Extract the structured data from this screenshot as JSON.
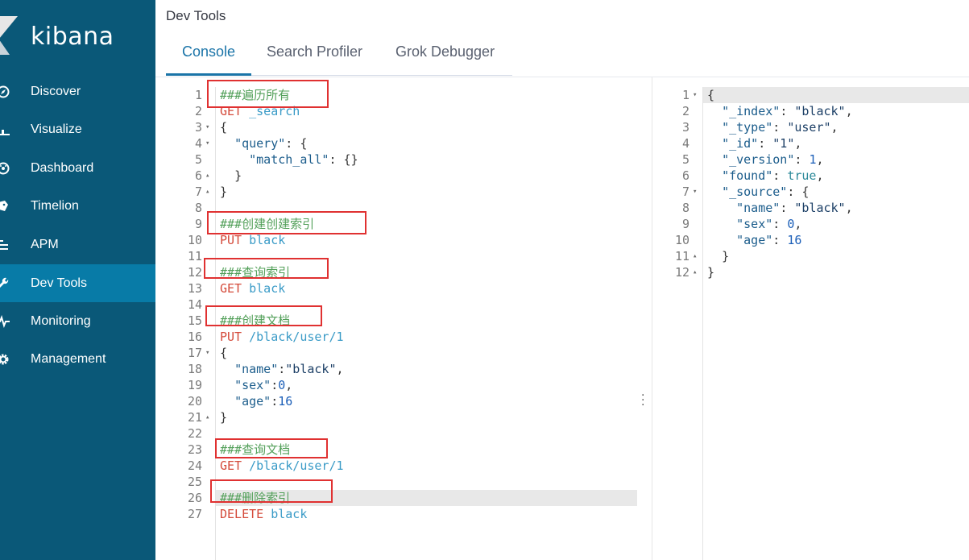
{
  "brand": {
    "name": "kibana"
  },
  "sidebar": {
    "items": [
      {
        "label": "Discover",
        "icon": "compass-icon"
      },
      {
        "label": "Visualize",
        "icon": "bar-chart-icon"
      },
      {
        "label": "Dashboard",
        "icon": "dashboard-icon"
      },
      {
        "label": "Timelion",
        "icon": "timelion-icon"
      },
      {
        "label": "APM",
        "icon": "apm-icon"
      },
      {
        "label": "Dev Tools",
        "icon": "wrench-icon",
        "active": true
      },
      {
        "label": "Monitoring",
        "icon": "heartbeat-icon"
      },
      {
        "label": "Management",
        "icon": "gear-icon"
      }
    ]
  },
  "header": {
    "title": "Dev Tools",
    "tabs": [
      {
        "label": "Console",
        "active": true
      },
      {
        "label": "Search Profiler"
      },
      {
        "label": "Grok Debugger"
      }
    ]
  },
  "request": {
    "lines": [
      {
        "n": "1",
        "text": "###遍历所有",
        "fold": ""
      },
      {
        "n": "2",
        "text": "GET _search",
        "fold": ""
      },
      {
        "n": "3",
        "text": "{",
        "fold": "▾"
      },
      {
        "n": "4",
        "text": "  \"query\": {",
        "fold": "▾"
      },
      {
        "n": "5",
        "text": "    \"match_all\": {}",
        "fold": ""
      },
      {
        "n": "6",
        "text": "  }",
        "fold": "▴"
      },
      {
        "n": "7",
        "text": "}",
        "fold": "▴"
      },
      {
        "n": "8",
        "text": "",
        "fold": ""
      },
      {
        "n": "9",
        "text": "###创建创建索引",
        "fold": ""
      },
      {
        "n": "10",
        "text": "PUT black",
        "fold": ""
      },
      {
        "n": "11",
        "text": "",
        "fold": ""
      },
      {
        "n": "12",
        "text": "###查询索引",
        "fold": ""
      },
      {
        "n": "13",
        "text": "GET black",
        "fold": ""
      },
      {
        "n": "14",
        "text": "",
        "fold": ""
      },
      {
        "n": "15",
        "text": "###创建文档",
        "fold": ""
      },
      {
        "n": "16",
        "text": "PUT /black/user/1",
        "fold": ""
      },
      {
        "n": "17",
        "text": "{",
        "fold": "▾"
      },
      {
        "n": "18",
        "text": "  \"name\":\"black\",",
        "fold": ""
      },
      {
        "n": "19",
        "text": "  \"sex\":0,",
        "fold": ""
      },
      {
        "n": "20",
        "text": "  \"age\":16",
        "fold": ""
      },
      {
        "n": "21",
        "text": "}",
        "fold": "▴"
      },
      {
        "n": "22",
        "text": "",
        "fold": ""
      },
      {
        "n": "23",
        "text": "###查询文档",
        "fold": ""
      },
      {
        "n": "24",
        "text": "GET /black/user/1",
        "fold": ""
      },
      {
        "n": "25",
        "text": "",
        "fold": ""
      },
      {
        "n": "26",
        "text": "###删除索引",
        "fold": ""
      },
      {
        "n": "27",
        "text": "DELETE black",
        "fold": ""
      }
    ]
  },
  "response": {
    "lines": [
      {
        "n": "1",
        "text": "{",
        "fold": "▾"
      },
      {
        "n": "2",
        "text": "  \"_index\": \"black\",",
        "fold": ""
      },
      {
        "n": "3",
        "text": "  \"_type\": \"user\",",
        "fold": ""
      },
      {
        "n": "4",
        "text": "  \"_id\": \"1\",",
        "fold": ""
      },
      {
        "n": "5",
        "text": "  \"_version\": 1,",
        "fold": ""
      },
      {
        "n": "6",
        "text": "  \"found\": true,",
        "fold": ""
      },
      {
        "n": "7",
        "text": "  \"_source\": {",
        "fold": "▾"
      },
      {
        "n": "8",
        "text": "    \"name\": \"black\",",
        "fold": ""
      },
      {
        "n": "9",
        "text": "    \"sex\": 0,",
        "fold": ""
      },
      {
        "n": "10",
        "text": "    \"age\": 16",
        "fold": ""
      },
      {
        "n": "11",
        "text": "  }",
        "fold": "▴"
      },
      {
        "n": "12",
        "text": "}",
        "fold": "▴"
      }
    ]
  },
  "colors": {
    "sidebar_bg": "#0a5878",
    "sidebar_active": "#087ba7",
    "accent": "#1a74a8",
    "annotation_box": "#e03131"
  }
}
